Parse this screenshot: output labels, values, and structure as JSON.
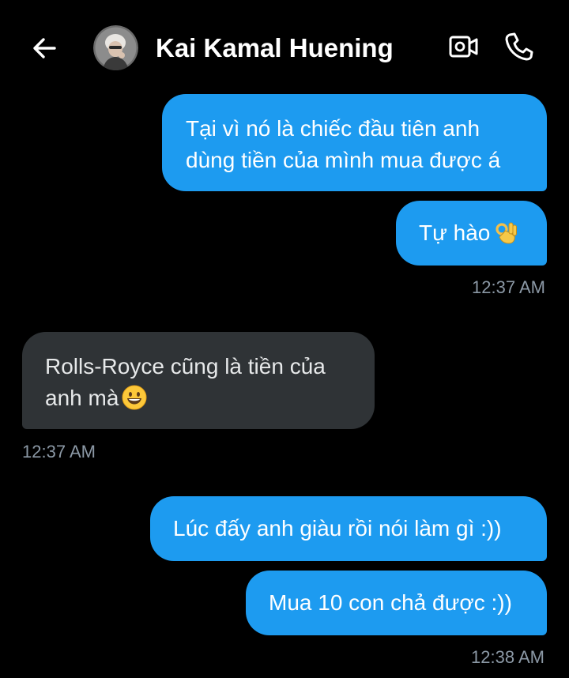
{
  "header": {
    "contact_name": "Kai Kamal Huening",
    "back_icon": "arrow-left-icon",
    "video_icon": "video-call-icon",
    "call_icon": "phone-icon"
  },
  "messages": [
    {
      "side": "out",
      "lines": [
        "Tại vì nó là chiếc đầu tiên anh",
        "dùng tiền của mình mua được á"
      ]
    },
    {
      "side": "out",
      "lines": [
        "Tự hào"
      ],
      "emoji": "ok-hand-emoji"
    },
    {
      "timestamp": "12:37 AM"
    },
    {
      "side": "in",
      "lines": [
        "Rolls-Royce cũng là tiền của",
        "anh mà"
      ],
      "emoji": "grinning-face-emoji"
    },
    {
      "timestamp": "12:37 AM"
    },
    {
      "side": "out",
      "lines": [
        "Lúc đấy anh giàu rồi nói làm gì :))"
      ]
    },
    {
      "side": "out",
      "lines": [
        "Mua 10 con chả được :))"
      ]
    },
    {
      "timestamp": "12:38 AM"
    }
  ],
  "colors": {
    "background": "#000000",
    "outgoing_bubble": "#1d9bf0",
    "incoming_bubble": "#2f3336",
    "timestamp": "#8b98a5"
  }
}
